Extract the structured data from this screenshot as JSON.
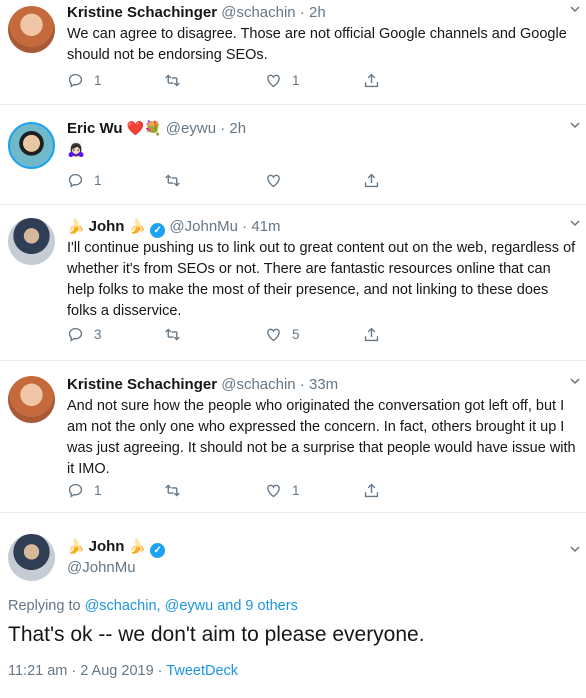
{
  "tweets": [
    {
      "name": "Kristine Schachinger",
      "handle": "@schachin",
      "time": "2h",
      "text": "We can agree to disagree. Those are not official Google channels and Google should not be endorsing SEOs.",
      "reply_count": "1",
      "retweet_count": "",
      "like_count": "1",
      "avatar_icon": "kristine-avatar"
    },
    {
      "name": "Eric Wu",
      "name_emoji": "❤️💐",
      "handle": "@eywu",
      "time": "2h",
      "text": "🙇🏻‍♀️",
      "reply_count": "1",
      "retweet_count": "",
      "like_count": "",
      "avatar_icon": "eric-avatar"
    },
    {
      "name": "John",
      "name_prefix_emoji": "🍌",
      "name_suffix_emoji": "🍌",
      "verified": true,
      "handle": "@JohnMu",
      "time": "41m",
      "text": "I'll continue pushing us to link out to great content out on the web, regardless of whether it's from SEOs or not. There are fantastic resources online that can help folks to make the most of their presence, and not linking to these does folks a disservice.",
      "reply_count": "3",
      "retweet_count": "",
      "like_count": "5",
      "avatar_icon": "john-avatar"
    },
    {
      "name": "Kristine Schachinger",
      "handle": "@schachin",
      "time": "33m",
      "text": "And not sure how the people who originated the conversation got left off, but I am not the only one who expressed the concern. In fact, others brought it up I was just agreeing. It should not be a surprise that people would have issue with it IMO.",
      "reply_count": "1",
      "retweet_count": "",
      "like_count": "1",
      "avatar_icon": "kristine-avatar"
    }
  ],
  "main_tweet": {
    "name": "John",
    "name_prefix_emoji": "🍌",
    "name_suffix_emoji": "🍌",
    "handle": "@JohnMu",
    "replying_prefix": "Replying to",
    "replying_user1": "@schachin",
    "replying_separator": ",",
    "replying_user2": "@eywu",
    "replying_others": "and 9 others",
    "text": "That's ok -- we don't aim to please everyone.",
    "timestamp": "11:21 am · 2 Aug 2019 ·",
    "source": "TweetDeck"
  },
  "colors": {
    "accent": "#1da1f2",
    "link": "#1b95e0",
    "muted": "#657786",
    "text": "#14171a",
    "divider": "#e6ecf0",
    "heart": "#e0245e"
  }
}
